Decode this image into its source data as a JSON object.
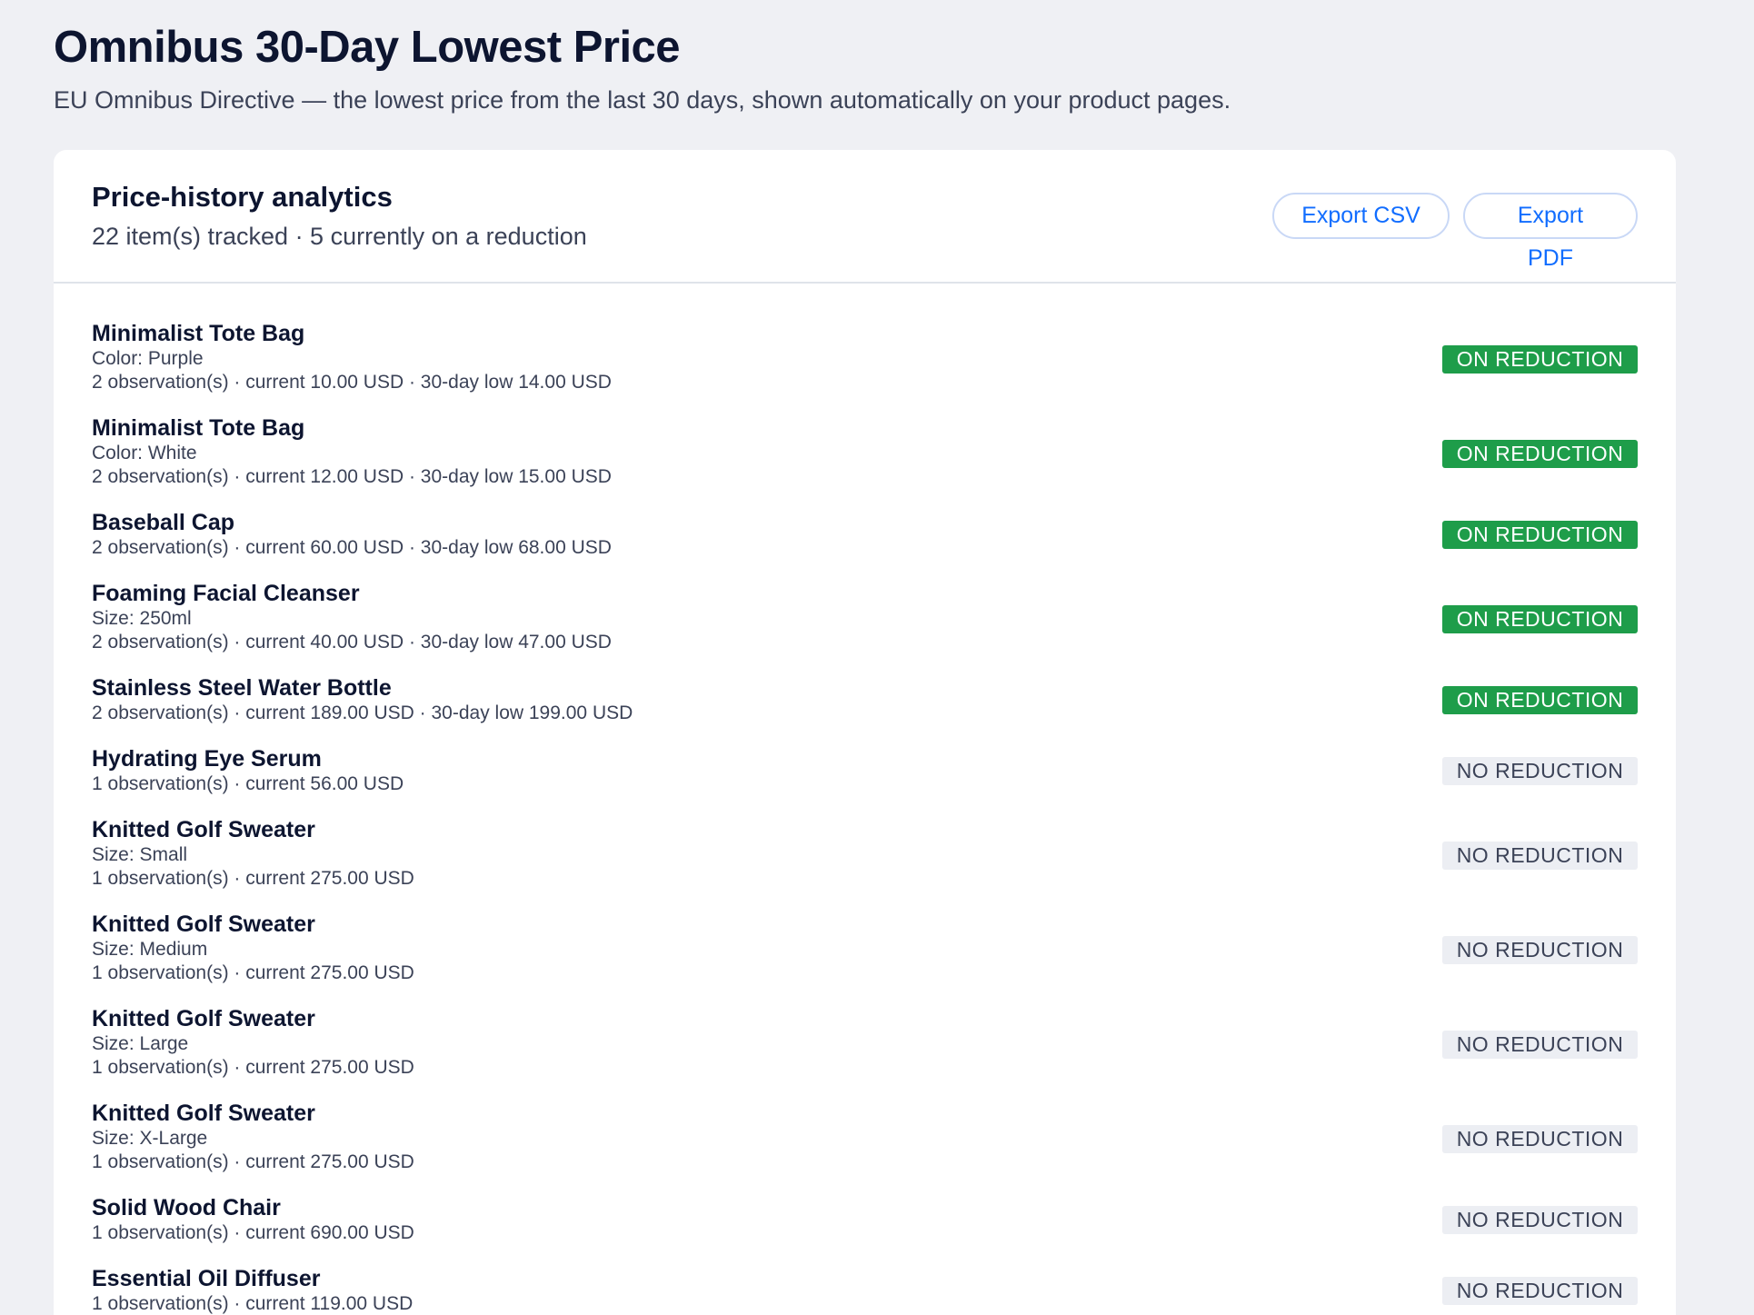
{
  "page": {
    "title": "Omnibus 30-Day Lowest Price",
    "subtitle": "EU Omnibus Directive — the lowest price from the last 30 days, shown automatically on your product pages."
  },
  "card": {
    "title": "Price-history analytics",
    "subtitle": "22 item(s) tracked · 5 currently on a reduction",
    "export_csv_label": "Export CSV",
    "export_pdf_label": "Export PDF"
  },
  "items": [
    {
      "name": "Minimalist Tote Bag",
      "variant": "Color: Purple",
      "stats": "2 observation(s) · current 10.00 USD · 30-day low 14.00 USD",
      "status": "ON REDUCTION",
      "on_reduction": true
    },
    {
      "name": "Minimalist Tote Bag",
      "variant": "Color: White",
      "stats": "2 observation(s) · current 12.00 USD · 30-day low 15.00 USD",
      "status": "ON REDUCTION",
      "on_reduction": true
    },
    {
      "name": "Baseball Cap",
      "variant": "",
      "stats": "2 observation(s) · current 60.00 USD · 30-day low 68.00 USD",
      "status": "ON REDUCTION",
      "on_reduction": true
    },
    {
      "name": "Foaming Facial Cleanser",
      "variant": "Size: 250ml",
      "stats": "2 observation(s) · current 40.00 USD · 30-day low 47.00 USD",
      "status": "ON REDUCTION",
      "on_reduction": true
    },
    {
      "name": "Stainless Steel Water Bottle",
      "variant": "",
      "stats": "2 observation(s) · current 189.00 USD · 30-day low 199.00 USD",
      "status": "ON REDUCTION",
      "on_reduction": true
    },
    {
      "name": "Hydrating Eye Serum",
      "variant": "",
      "stats": "1 observation(s) · current 56.00 USD",
      "status": "NO REDUCTION",
      "on_reduction": false
    },
    {
      "name": "Knitted Golf Sweater",
      "variant": "Size: Small",
      "stats": "1 observation(s) · current 275.00 USD",
      "status": "NO REDUCTION",
      "on_reduction": false
    },
    {
      "name": "Knitted Golf Sweater",
      "variant": "Size: Medium",
      "stats": "1 observation(s) · current 275.00 USD",
      "status": "NO REDUCTION",
      "on_reduction": false
    },
    {
      "name": "Knitted Golf Sweater",
      "variant": "Size: Large",
      "stats": "1 observation(s) · current 275.00 USD",
      "status": "NO REDUCTION",
      "on_reduction": false
    },
    {
      "name": "Knitted Golf Sweater",
      "variant": "Size: X-Large",
      "stats": "1 observation(s) · current 275.00 USD",
      "status": "NO REDUCTION",
      "on_reduction": false
    },
    {
      "name": "Solid Wood Chair",
      "variant": "",
      "stats": "1 observation(s) · current 690.00 USD",
      "status": "NO REDUCTION",
      "on_reduction": false
    },
    {
      "name": "Essential Oil Diffuser",
      "variant": "",
      "stats": "1 observation(s) · current 119.00 USD",
      "status": "NO REDUCTION",
      "on_reduction": false
    }
  ],
  "colors": {
    "accent": "#116dff",
    "on_reduction": "#1e9d4a",
    "no_reduction_bg": "#eceef3",
    "background": "#eff0f4"
  }
}
